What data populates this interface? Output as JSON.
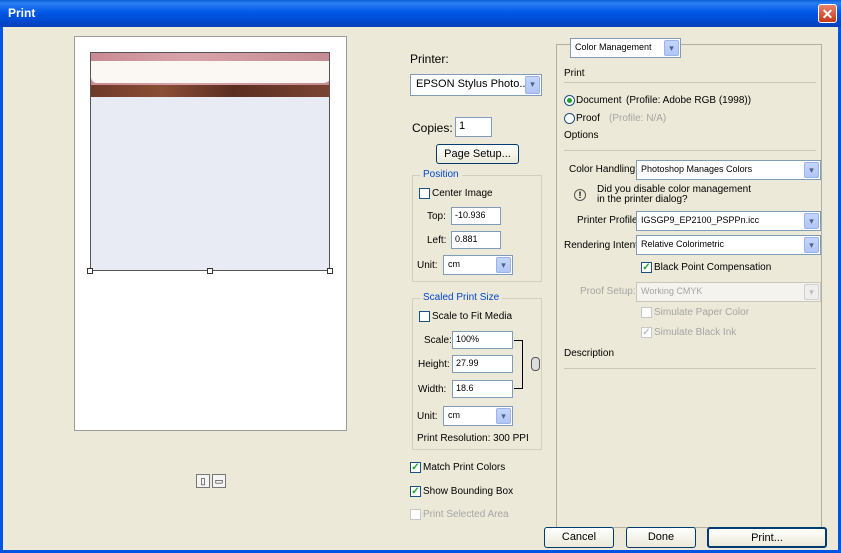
{
  "window": {
    "title": "Print",
    "close_glyph": "✕"
  },
  "printer": {
    "label": "Printer:",
    "selected": "EPSON Stylus Photo...",
    "copies_label": "Copies:",
    "copies_value": "1",
    "page_setup_label": "Page Setup..."
  },
  "position": {
    "legend": "Position",
    "center_image_label": "Center Image",
    "center_image_checked": false,
    "top_label": "Top:",
    "top_value": "-10.936",
    "left_label": "Left:",
    "left_value": "0.881",
    "unit_label": "Unit:",
    "unit_value": "cm"
  },
  "scaled": {
    "legend": "Scaled Print Size",
    "scale_to_fit_label": "Scale to Fit Media",
    "scale_to_fit_checked": false,
    "scale_label": "Scale:",
    "scale_value": "100%",
    "height_label": "Height:",
    "height_value": "27.99",
    "width_label": "Width:",
    "width_value": "18.6",
    "unit_label": "Unit:",
    "unit_value": "cm",
    "resolution_text": "Print Resolution: 300 PPI"
  },
  "options_bottom": {
    "match_print_colors": "Match Print Colors",
    "match_print_colors_checked": true,
    "show_bounding_box": "Show Bounding Box",
    "show_bounding_box_checked": true,
    "print_selected_area": "Print Selected Area",
    "print_selected_area_checked": false
  },
  "color_management": {
    "mode_select": "Color Management",
    "print_heading": "Print",
    "document_label": "Document",
    "document_profile": "(Profile: Adobe RGB (1998))",
    "document_selected": true,
    "proof_label": "Proof",
    "proof_profile": "(Profile: N/A)",
    "options_heading": "Options",
    "color_handling_label": "Color Handling:",
    "color_handling_value": "Photoshop Manages Colors",
    "warning_line1": "Did you disable color management",
    "warning_line2": "in the printer dialog?",
    "printer_profile_label": "Printer Profile:",
    "printer_profile_value": "IGSGP9_EP2100_PSPPn.icc",
    "rendering_intent_label": "Rendering Intent:",
    "rendering_intent_value": "Relative Colorimetric",
    "black_point_label": "Black Point Compensation",
    "black_point_checked": true,
    "proof_setup_label": "Proof Setup:",
    "proof_setup_value": "Working CMYK",
    "simulate_paper_label": "Simulate Paper Color",
    "simulate_paper_checked": false,
    "simulate_ink_label": "Simulate Black Ink",
    "simulate_ink_checked": true,
    "description_heading": "Description"
  },
  "buttons": {
    "cancel": "Cancel",
    "done": "Done",
    "print": "Print..."
  },
  "icons": {
    "dropdown": "▾",
    "check": "✓",
    "warning": "!",
    "link": "🔗",
    "portrait": "▯",
    "landscape": "▭"
  },
  "colors": {
    "titlebar": "#0054e3",
    "dialog_bg": "#ece9d8",
    "legend_blue": "#0046d5",
    "check_green": "#21a121"
  }
}
